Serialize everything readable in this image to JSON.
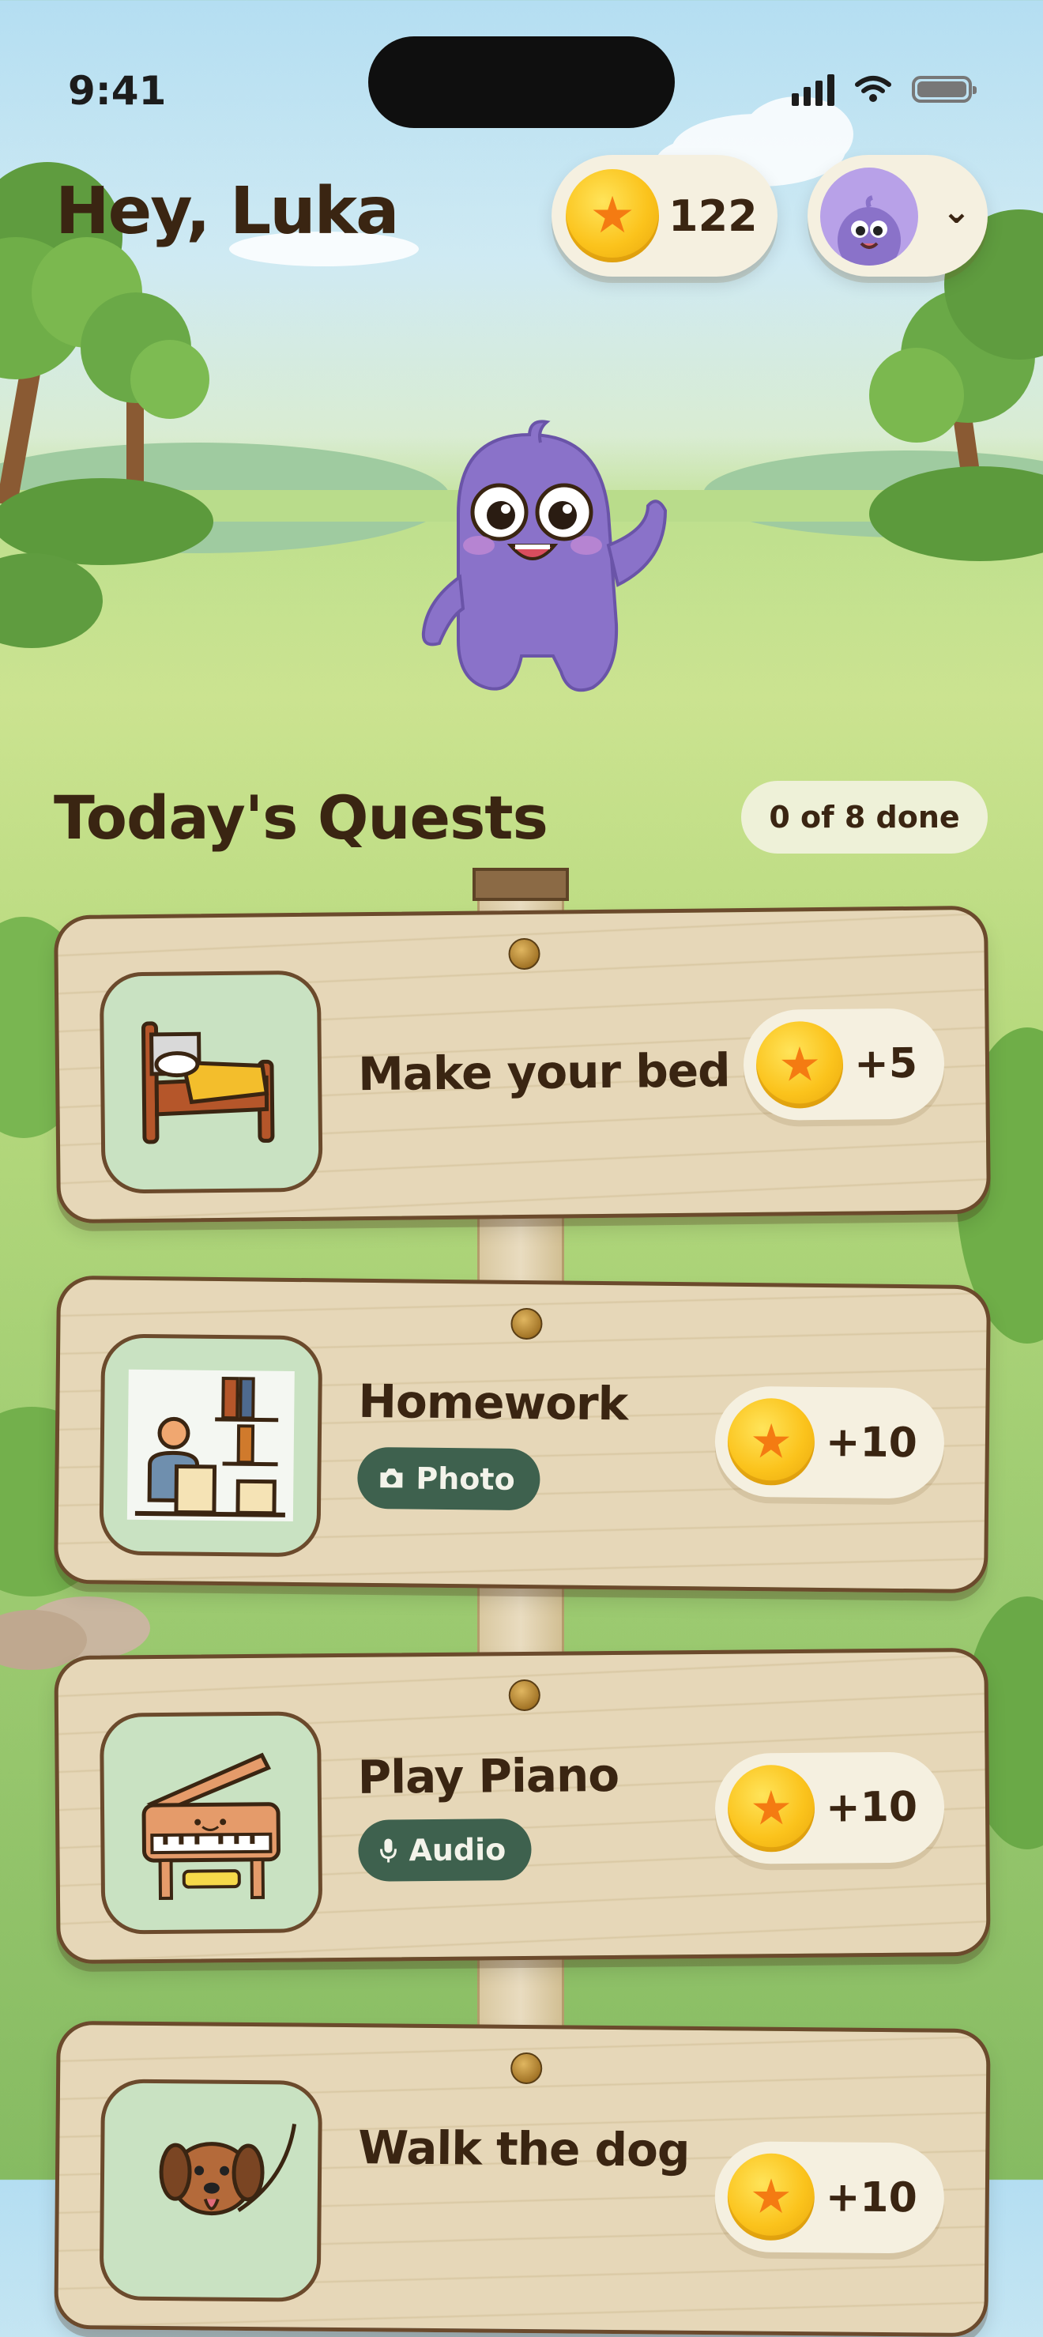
{
  "status_bar": {
    "time": "9:41"
  },
  "header": {
    "greeting": "Hey, Luka",
    "coins": "122",
    "coin_icon": "star-coin-icon",
    "avatar_icon": "monster-avatar-icon",
    "dropdown_icon": "chevron-down-icon"
  },
  "quests_section": {
    "title": "Today's Quests",
    "progress": "0 of 8 done"
  },
  "quests": [
    {
      "title": "Make your bed",
      "icon": "bed-icon",
      "reward": "+5",
      "tag": ""
    },
    {
      "title": "Homework",
      "icon": "homework-icon",
      "reward": "+10",
      "tag": "Photo",
      "tag_icon": "camera-icon"
    },
    {
      "title": "Play Piano",
      "icon": "piano-icon",
      "reward": "+10",
      "tag": "Audio",
      "tag_icon": "microphone-icon"
    },
    {
      "title": "Walk the dog",
      "icon": "dog-icon",
      "reward": "+10",
      "tag": ""
    }
  ],
  "colors": {
    "text_brown": "#3a2512",
    "plank": "#e6d7b8",
    "plank_border": "#6b4a2c",
    "tag_green": "#3e614e",
    "coin_gold": "#fbc31c",
    "mascot_purple": "#8a72c9"
  }
}
